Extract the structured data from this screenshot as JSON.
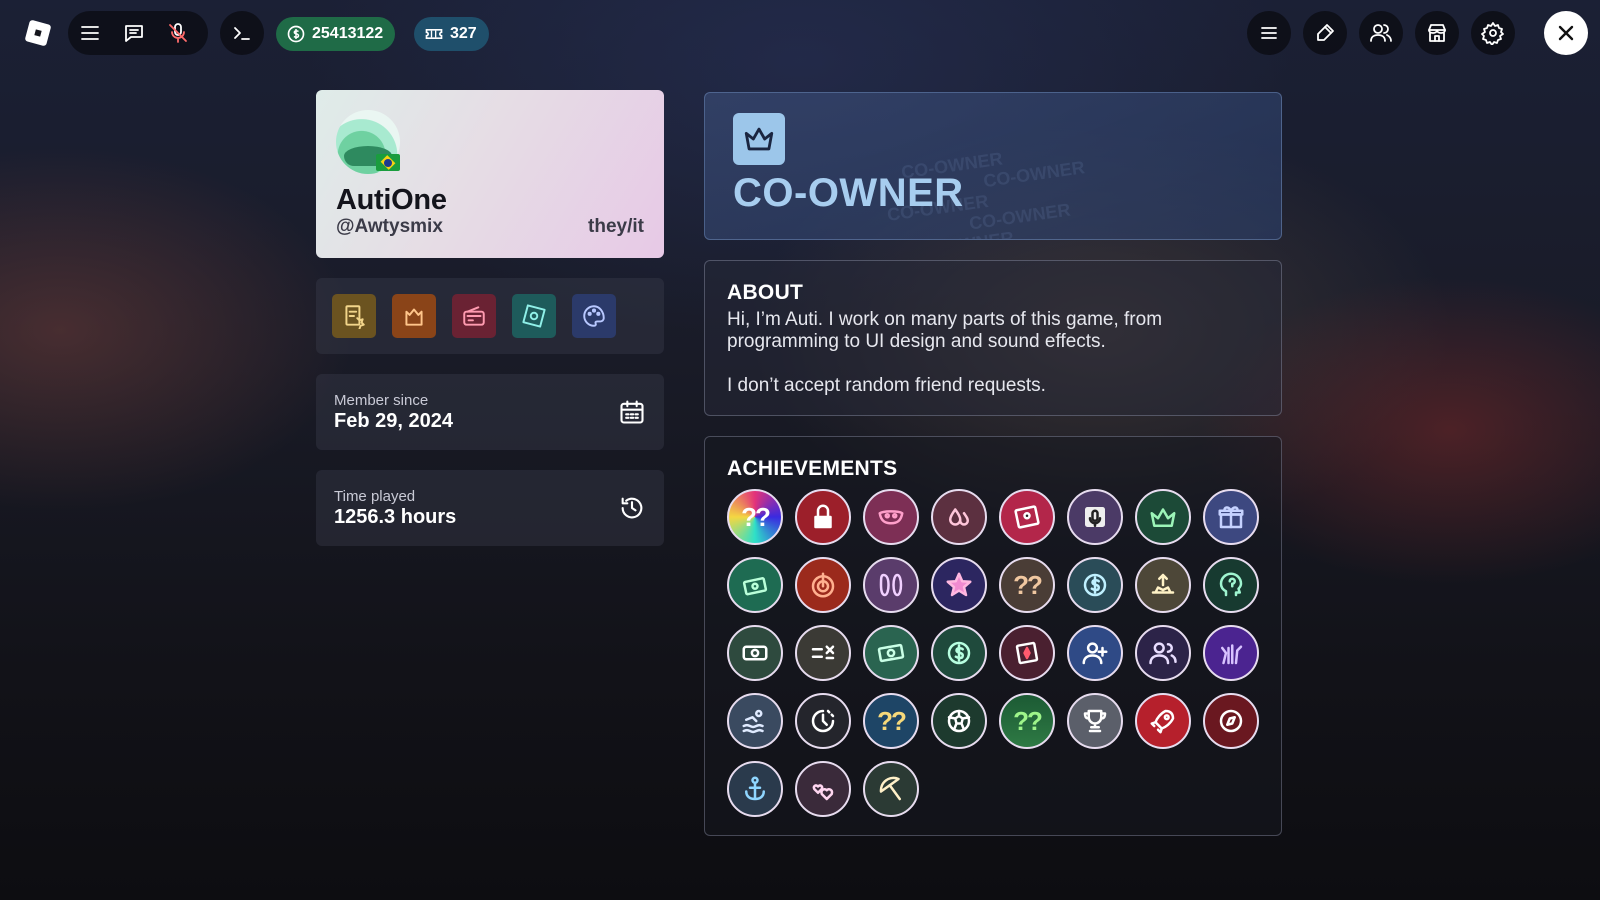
{
  "topbar": {
    "robux": "25413122",
    "tickets": "327"
  },
  "profile": {
    "display_name": "AutiOne",
    "username": "@Awtysmix",
    "pronouns": "they/it"
  },
  "stats": {
    "member_label": "Member since",
    "member_value": "Feb 29, 2024",
    "time_label": "Time played",
    "time_value": "1256.3 hours"
  },
  "role": {
    "title": "CO-OWNER"
  },
  "about": {
    "title": "ABOUT",
    "text": "Hi, I’m Auti. I work on many parts of this game, from programming to UI design and sound effects.\n\nI don’t accept random friend requests."
  },
  "achievements": {
    "title": "ACHIEVEMENTS",
    "icons": [
      "mystery-glitch",
      "lock",
      "mask",
      "drops",
      "sticker",
      "microphone",
      "crown",
      "gift",
      "money-stack",
      "target",
      "shoes",
      "star",
      "mystery",
      "coin",
      "rank-up",
      "brain",
      "cash",
      "math",
      "money",
      "dollar",
      "diamond-frame",
      "add-friend",
      "friends",
      "hand",
      "swim",
      "clock",
      "mystery-blue",
      "soccer",
      "mystery-green",
      "trophy",
      "rocket",
      "compass",
      "anchor",
      "hearts",
      "umbrella"
    ]
  },
  "colors": {
    "accent_green": "#1f6b47",
    "accent_blue": "#1f4f6b",
    "role_color": "#a7cdef"
  }
}
